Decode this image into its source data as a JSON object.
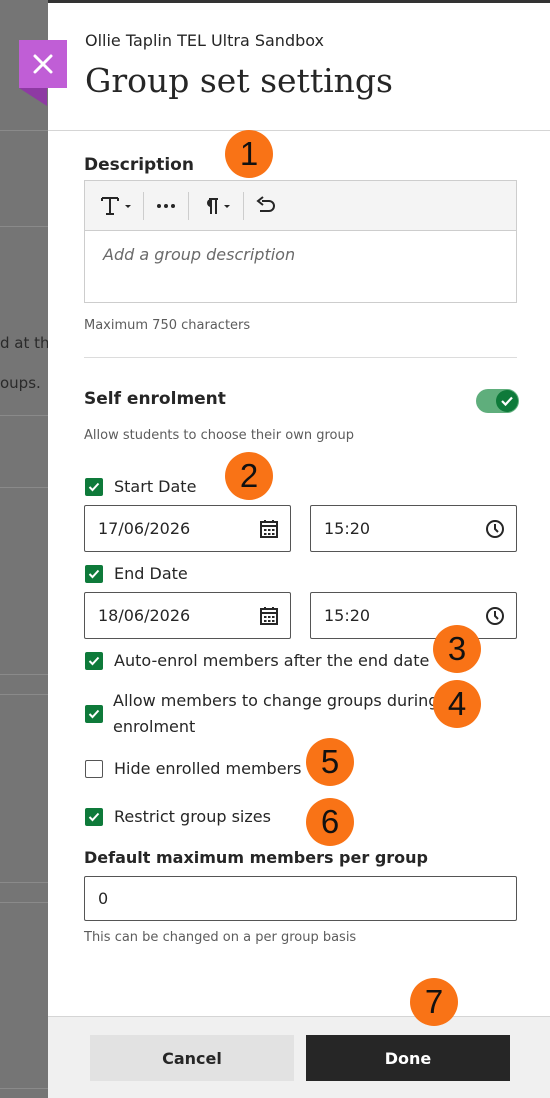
{
  "background": {
    "fragment_1": "d at th",
    "fragment_2": "oups."
  },
  "panel": {
    "course_name": "Ollie Taplin TEL Ultra Sandbox",
    "title": "Group set settings"
  },
  "description": {
    "label": "Description",
    "placeholder": "Add a group description",
    "hint": "Maximum 750 characters",
    "toolbar": {
      "text_style_icon": "text-format-icon",
      "more_icon": "more-icon",
      "paragraph_icon": "paragraph-icon",
      "undo_icon": "undo-icon"
    }
  },
  "self_enrolment": {
    "label": "Self enrolment",
    "hint": "Allow students to choose their own group",
    "enabled": true
  },
  "start_date": {
    "label": "Start Date",
    "checked": true,
    "date": "17/06/2026",
    "time": "15:20"
  },
  "end_date": {
    "label": "End Date",
    "checked": true,
    "date": "18/06/2026",
    "time": "15:20"
  },
  "options": {
    "auto_enrol": {
      "label": "Auto-enrol members after the end date",
      "checked": true
    },
    "allow_change_line1": "Allow members to change groups during",
    "allow_change_line2": "enrolment",
    "allow_change_checked": true,
    "hide_enrolled": {
      "label": "Hide enrolled members",
      "checked": false
    },
    "restrict_sizes": {
      "label": "Restrict group sizes",
      "checked": true
    }
  },
  "max_members": {
    "label": "Default maximum members per group",
    "value": "0",
    "hint": "This can be changed on a per group basis"
  },
  "badges": [
    "1",
    "2",
    "3",
    "4",
    "5",
    "6",
    "7"
  ],
  "footer": {
    "cancel_label": "Cancel",
    "done_label": "Done"
  },
  "colors": {
    "accent_close": "#c05ed6",
    "checkbox_green": "#0e7a3a",
    "badge_orange": "#f97316",
    "done_button": "#262626"
  }
}
